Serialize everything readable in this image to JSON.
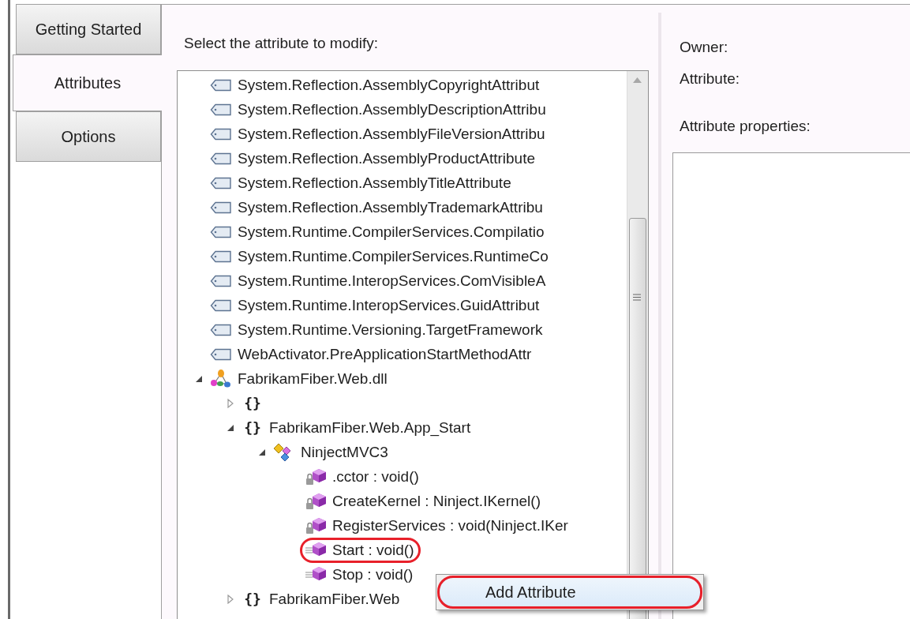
{
  "tabs": [
    {
      "label": "Getting Started",
      "selected": false
    },
    {
      "label": "Attributes",
      "selected": true
    },
    {
      "label": "Options",
      "selected": false
    }
  ],
  "attribute_picker": {
    "label": "Select the attribute to modify:",
    "tree": [
      {
        "kind": "attribute",
        "label": "System.Reflection.AssemblyCopyrightAttribut"
      },
      {
        "kind": "attribute",
        "label": "System.Reflection.AssemblyDescriptionAttribu"
      },
      {
        "kind": "attribute",
        "label": "System.Reflection.AssemblyFileVersionAttribu"
      },
      {
        "kind": "attribute",
        "label": "System.Reflection.AssemblyProductAttribute"
      },
      {
        "kind": "attribute",
        "label": "System.Reflection.AssemblyTitleAttribute"
      },
      {
        "kind": "attribute",
        "label": "System.Reflection.AssemblyTrademarkAttribu"
      },
      {
        "kind": "attribute",
        "label": "System.Runtime.CompilerServices.Compilatio"
      },
      {
        "kind": "attribute",
        "label": "System.Runtime.CompilerServices.RuntimeCo"
      },
      {
        "kind": "attribute",
        "label": "System.Runtime.InteropServices.ComVisibleA"
      },
      {
        "kind": "attribute",
        "label": "System.Runtime.InteropServices.GuidAttribut"
      },
      {
        "kind": "attribute",
        "label": "System.Runtime.Versioning.TargetFramework"
      },
      {
        "kind": "attribute",
        "label": "WebActivator.PreApplicationStartMethodAttr"
      },
      {
        "kind": "assembly",
        "label": "FabrikamFiber.Web.dll",
        "expanded": true,
        "children": [
          {
            "kind": "namespace",
            "icon": "{}",
            "expanded": false
          },
          {
            "kind": "namespace",
            "icon": "{}",
            "label": "FabrikamFiber.Web.App_Start",
            "expanded": true,
            "children": [
              {
                "kind": "class",
                "label": "NinjectMVC3",
                "expanded": true,
                "children": [
                  {
                    "kind": "method",
                    "locked": true,
                    "label": ".cctor : void()",
                    "circled": false
                  },
                  {
                    "kind": "method",
                    "locked": true,
                    "label": "CreateKernel : Ninject.IKernel()",
                    "circled": false
                  },
                  {
                    "kind": "method",
                    "locked": true,
                    "label": "RegisterServices : void(Ninject.IKer",
                    "circled": false
                  },
                  {
                    "kind": "method",
                    "locked": false,
                    "label": "Start : void()",
                    "circled": true
                  },
                  {
                    "kind": "method",
                    "locked": false,
                    "label": "Stop : void()",
                    "circled": false
                  }
                ]
              }
            ]
          },
          {
            "kind": "namespace",
            "icon": "{}",
            "label": "FabrikamFiber.Web",
            "expanded": false
          }
        ]
      }
    ]
  },
  "details": {
    "owner_label": "Owner:",
    "attribute_label": "Attribute:",
    "properties_label": "Attribute properties:"
  },
  "context_menu": {
    "items": [
      {
        "label": "Add Attribute",
        "circled": true
      }
    ]
  }
}
